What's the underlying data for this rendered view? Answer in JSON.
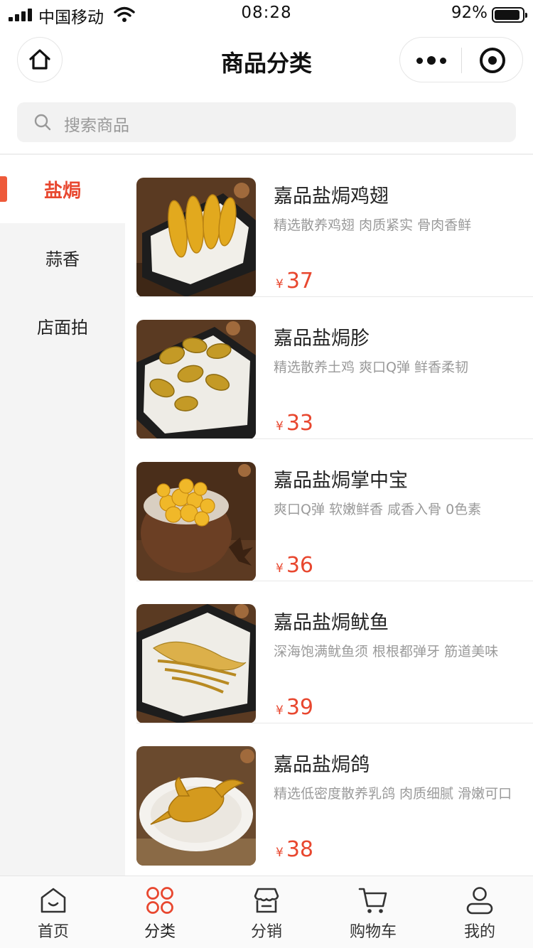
{
  "status_bar": {
    "carrier": "中国移动",
    "time": "08:28",
    "battery": "92%",
    "battery_level": 0.92
  },
  "nav": {
    "title": "商品分类"
  },
  "search": {
    "placeholder": "搜索商品"
  },
  "categories": [
    {
      "label": "盐焗",
      "active": true
    },
    {
      "label": "蒜香",
      "active": false
    },
    {
      "label": "店面拍",
      "active": false
    }
  ],
  "products": [
    {
      "name": "嘉品盐焗鸡翅",
      "desc": "精选散养鸡翅 肉质紧实 骨肉香鲜",
      "currency": "¥",
      "price": "37"
    },
    {
      "name": "嘉品盐焗胗",
      "desc": "精选散养土鸡 爽口Q弹 鲜香柔韧",
      "currency": "¥",
      "price": "33"
    },
    {
      "name": "嘉品盐焗掌中宝",
      "desc": "爽口Q弹 软嫩鲜香 咸香入骨 0色素",
      "currency": "¥",
      "price": "36"
    },
    {
      "name": "嘉品盐焗鱿鱼",
      "desc": "深海饱满鱿鱼须 根根都弹牙 筋道美味",
      "currency": "¥",
      "price": "39"
    },
    {
      "name": "嘉品盐焗鸽",
      "desc": "精选低密度散养乳鸽 肉质细腻 滑嫩可口",
      "currency": "¥",
      "price": "38"
    }
  ],
  "tabbar": [
    {
      "label": "首页",
      "icon": "home-icon"
    },
    {
      "label": "分类",
      "icon": "category-icon"
    },
    {
      "label": "分销",
      "icon": "store-icon"
    },
    {
      "label": "购物车",
      "icon": "cart-icon"
    },
    {
      "label": "我的",
      "icon": "user-icon"
    }
  ],
  "colors": {
    "accent": "#e8472f",
    "sidebar_bg": "#f4f4f4"
  }
}
